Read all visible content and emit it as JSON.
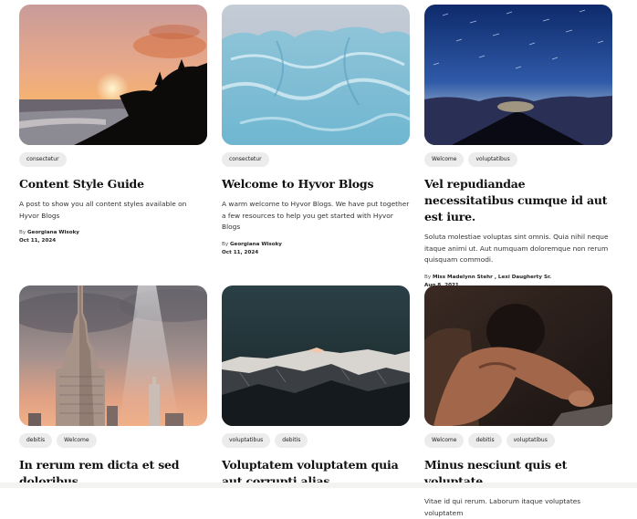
{
  "posts": [
    {
      "image": "sunset-beach",
      "tags": [
        "consectetur"
      ],
      "title": "Content Style Guide",
      "excerpt": "A post to show you all content styles available on Hyvor Blogs",
      "by": "By",
      "author": "Georgiana Wisoky",
      "date": "Oct 11, 2024"
    },
    {
      "image": "blue-ice",
      "tags": [
        "consectetur"
      ],
      "title": "Welcome to Hyvor Blogs",
      "excerpt": "A warm welcome to Hyvor Blogs. We have put together a few resources to help you get started with Hyvor Blogs",
      "by": "By",
      "author": "Georgiana Wisoky",
      "date": "Oct 11, 2024"
    },
    {
      "image": "starry-mountain",
      "tags": [
        "Welcome",
        "voluptatibus"
      ],
      "title": "Vel repudiandae necessitatibus cumque id aut est iure.",
      "excerpt": "Soluta molestiae voluptas sint omnis. Quia nihil neque itaque animi ut. Aut numquam doloremque non rerum quisquam commodi.",
      "by": "By",
      "author": "Miss Madelynn Stehr , Lexi Daugherty Sr.",
      "date": "Aug 8, 2021"
    },
    {
      "image": "empire-state",
      "tags": [
        "debitis",
        "Welcome"
      ],
      "title": "In rerum rem dicta et sed doloribus.",
      "excerpt": "",
      "by": "",
      "author": "",
      "date": ""
    },
    {
      "image": "snowy-ridge",
      "tags": [
        "voluptatibus",
        "debitis"
      ],
      "title": "Voluptatem voluptatem quia aut corrupti alias.",
      "excerpt": "",
      "by": "",
      "author": "",
      "date": ""
    },
    {
      "image": "climber",
      "tags": [
        "Welcome",
        "debitis",
        "voluptatibus"
      ],
      "title": "Minus nesciunt quis et voluptate.",
      "excerpt": "Vitae id qui rerum. Laborum itaque voluptates voluptatem",
      "by": "",
      "author": "",
      "date": ""
    }
  ]
}
